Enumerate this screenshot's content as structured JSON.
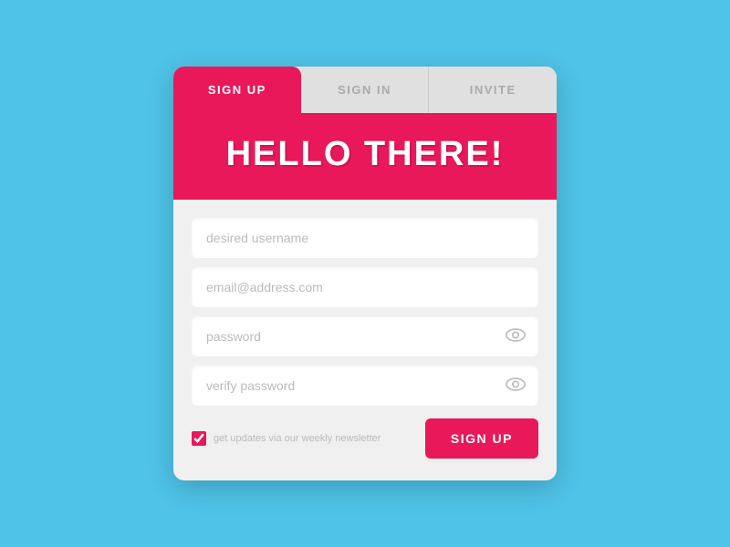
{
  "tabs": {
    "signup": {
      "label": "SIGN UP",
      "active": true
    },
    "signin": {
      "label": "SIGN IN",
      "active": false
    },
    "invite": {
      "label": "INVITE",
      "active": false
    }
  },
  "header": {
    "title": "HELLO THERE!"
  },
  "form": {
    "username_placeholder": "desired username",
    "email_placeholder": "email@address.com",
    "password_placeholder": "password",
    "verify_placeholder": "verify password",
    "newsletter_label": "get updates via our weekly newsletter",
    "submit_label": "SIGN UP"
  },
  "colors": {
    "brand_pink": "#e8185a",
    "background_blue": "#4fc3e8",
    "tab_bg": "#e0e0e0"
  }
}
